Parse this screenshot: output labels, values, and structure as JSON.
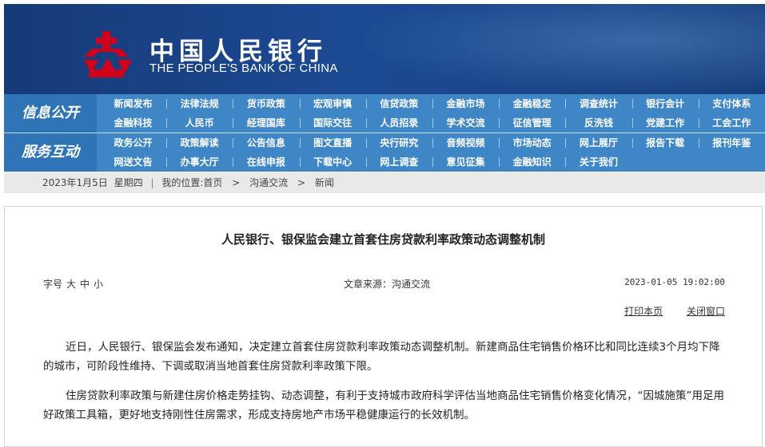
{
  "header": {
    "cn_name": "中国人民银行",
    "en_name": "THE PEOPLE'S BANK OF CHINA"
  },
  "nav": {
    "group1_title": "信息公开",
    "group1_links": [
      "新闻发布",
      "法律法规",
      "货币政策",
      "宏观审慎",
      "信贷政策",
      "金融市场",
      "金融稳定",
      "调查统计",
      "银行会计",
      "支付体系",
      "金融科技",
      "人民币",
      "经理国库",
      "国际交往",
      "人员招录",
      "学术交流",
      "征信管理",
      "反洗钱",
      "党建工作",
      "工会工作"
    ],
    "group2_title": "服务互动",
    "group2_links": [
      "政务公开",
      "政策解读",
      "公告信息",
      "图文直播",
      "央行研究",
      "音频视频",
      "市场动态",
      "网上展厅",
      "报告下载",
      "报刊年鉴",
      "网送文告",
      "办事大厅",
      "在线申报",
      "下载中心",
      "网上调查",
      "意见征集",
      "金融知识",
      "关于我们"
    ]
  },
  "breadcrumb": {
    "date": "2023年1月5日",
    "weekday": "星期四",
    "sep": "|",
    "location_label": "我的位置:",
    "home": "首页",
    "arrow1": ">",
    "level1": "沟通交流",
    "arrow2": ">",
    "level2": "新闻"
  },
  "article": {
    "title": "人民银行、银保监会建立首套住房贷款利率政策动态调整机制",
    "font_size_label": "字号",
    "font_large": "大",
    "font_medium": "中",
    "font_small": "小",
    "source": "文章来源：沟通交流",
    "datetime": "2023-01-05 19:02:00",
    "print_label": "打印本页",
    "close_label": "关闭窗口",
    "paragraphs": [
      "近日，人民银行、银保监会发布通知，决定建立首套住房贷款利率政策动态调整机制。新建商品住宅销售价格环比和同比连续3个月均下降的城市，可阶段性维持、下调或取消当地首套住房贷款利率政策下限。",
      "住房贷款利率政策与新建住房价格走势挂钩、动态调整，有利于支持城市政府科学评估当地商品住宅销售价格变化情况，“因城施策”用足用好政策工具箱，更好地支持刚性住房需求，形成支持房地产市场平稳健康运行的长效机制。"
    ]
  },
  "colors": {
    "banner": "#1c4a92",
    "nav": "#3f86c6",
    "nav_head": "#2f74b7",
    "logo_red": "#d0021b"
  }
}
